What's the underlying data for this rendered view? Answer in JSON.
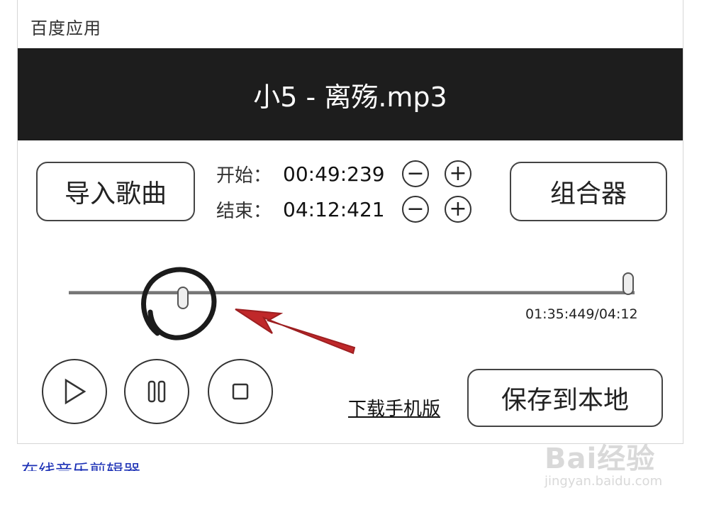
{
  "app": {
    "title": "百度应用"
  },
  "banner": {
    "song_title": "小5 - 离殇.mp3"
  },
  "buttons": {
    "import": "导入歌曲",
    "combiner": "组合器",
    "save_local": "保存到本地"
  },
  "times": {
    "start_label": "开始：",
    "start_value": "00:49:239",
    "end_label": "结束：",
    "end_value": "04:12:421",
    "minus_glyph": "−",
    "plus_glyph": "+"
  },
  "progress": {
    "text": "01:35:449/04:12"
  },
  "links": {
    "download_mobile": "下载手机版"
  },
  "footer": {
    "text": "在线音乐剪辑器"
  },
  "watermark": {
    "brand": "Bai经验",
    "url": "jingyan.baidu.com"
  },
  "colors": {
    "banner_bg": "#1d1d1d",
    "arrow": "#c0282a",
    "link_blue": "#1a2fb5"
  }
}
